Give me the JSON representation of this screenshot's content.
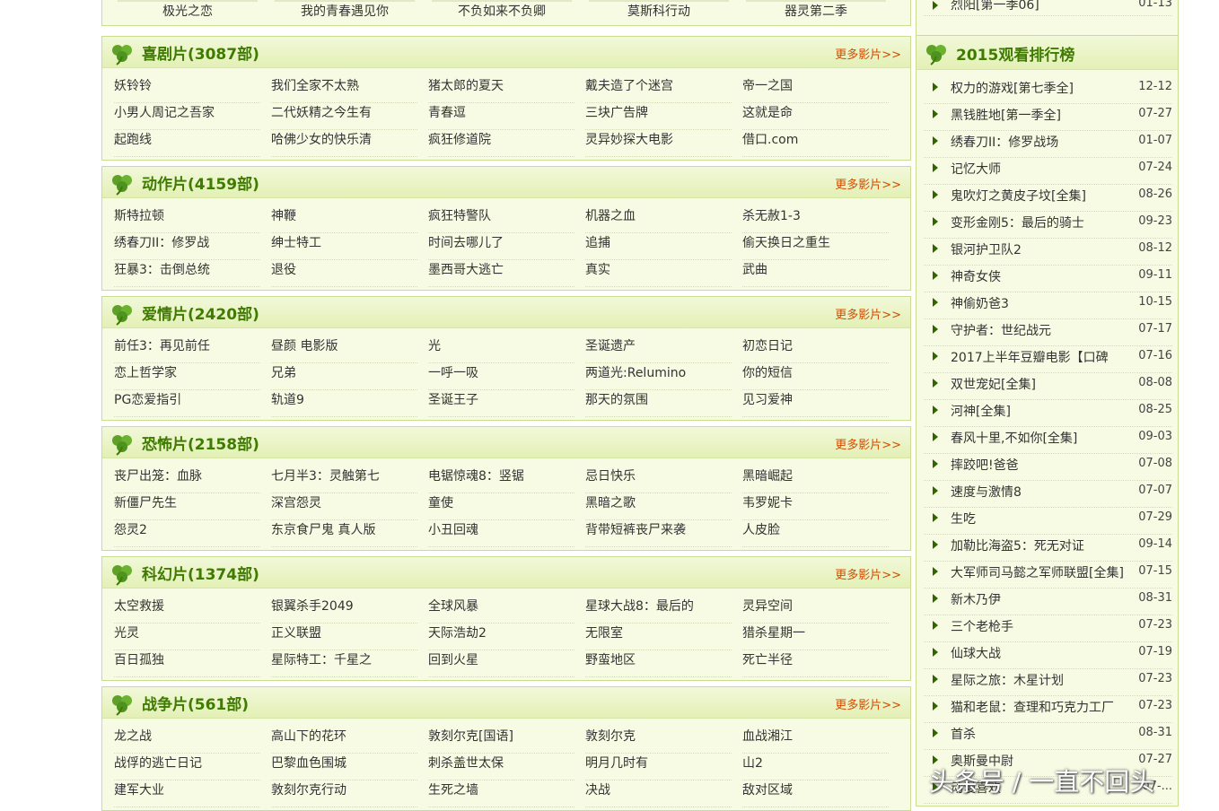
{
  "top_row": [
    "极光之恋",
    "我的青春遇见你",
    "不负如来不负卿",
    "莫斯科行动",
    "器灵第二季"
  ],
  "more_label": "更多影片>>",
  "sections": [
    {
      "title": "喜剧片(3087部)",
      "items": [
        "妖铃铃",
        "我们全家不太熟",
        "猪太郎的夏天",
        "戴夫造了个迷宫",
        "帝一之国",
        "小男人周记之吾家",
        "二代妖精之今生有",
        "青春逗",
        "三块广告牌",
        "这就是命",
        "起跑线",
        "哈佛少女的快乐清",
        "疯狂修道院",
        "灵异妙探大电影",
        "借口.com"
      ]
    },
    {
      "title": "动作片(4159部)",
      "items": [
        "斯特拉顿",
        "神鞭",
        "疯狂特警队",
        "机器之血",
        "杀无赦1-3",
        "绣春刀II：修罗战",
        "绅士特工",
        "时间去哪儿了",
        "追捕",
        "偷天换日之重生",
        "狂暴3：击倒总统",
        "退役",
        "墨西哥大逃亡",
        "真实",
        "武曲"
      ]
    },
    {
      "title": "爱情片(2420部)",
      "items": [
        "前任3：再见前任",
        "昼颜 电影版",
        "光",
        "圣诞遗产",
        "初恋日记",
        "恋上哲学家",
        "兄弟",
        "一呼一吸",
        "两道光:Relumino",
        "你的短信",
        "PG恋爱指引",
        "轨道9",
        "圣诞王子",
        "那天的氛围",
        "见习爱神"
      ]
    },
    {
      "title": "恐怖片(2158部)",
      "items": [
        "丧尸出笼：血脉",
        "七月半3：灵触第七",
        "电锯惊魂8：竖锯",
        "忌日快乐",
        "黑暗崛起",
        "新僵尸先生",
        "深宫怨灵",
        "童使",
        "黑暗之歌",
        "韦罗妮卡",
        "怨灵2",
        "东京食尸鬼 真人版",
        "小丑回魂",
        "背带短裤丧尸来袭",
        "人皮脸"
      ]
    },
    {
      "title": "科幻片(1374部)",
      "items": [
        "太空救援",
        "银翼杀手2049",
        "全球风暴",
        "星球大战8：最后的",
        "灵异空间",
        "光灵",
        "正义联盟",
        "天际浩劫2",
        "无限室",
        "猎杀星期一",
        "百日孤独",
        "星际特工：千星之",
        "回到火星",
        "野蛮地区",
        "死亡半径"
      ]
    },
    {
      "title": "战争片(561部)",
      "items": [
        "龙之战",
        "高山下的花环",
        "敦刻尔克[国语]",
        "敦刻尔克",
        "血战湘江",
        "战俘的逃亡日记",
        "巴黎血色围城",
        "刺杀盖世太保",
        "明月几时有",
        "山2",
        "建军大业",
        "敦刻尔克行动",
        "生死之墙",
        "决战",
        "敌对区域"
      ]
    }
  ],
  "sidebar": {
    "top_partial": {
      "title": "烈阳[第一季06]",
      "date": "01-13"
    },
    "title": "2015观看排行榜",
    "items": [
      {
        "title": "权力的游戏[第七季全]",
        "date": "12-12"
      },
      {
        "title": "黑钱胜地[第一季全]",
        "date": "07-27"
      },
      {
        "title": "绣春刀II：修罗战场",
        "date": "01-07"
      },
      {
        "title": "记忆大师",
        "date": "07-24"
      },
      {
        "title": "鬼吹灯之黄皮子坟[全集]",
        "date": "08-26"
      },
      {
        "title": "变形金刚5：最后的骑士",
        "date": "09-23"
      },
      {
        "title": "银河护卫队2",
        "date": "08-12"
      },
      {
        "title": "神奇女侠",
        "date": "09-11"
      },
      {
        "title": "神偷奶爸3",
        "date": "10-15"
      },
      {
        "title": "守护者：世纪战元",
        "date": "07-17"
      },
      {
        "title": "2017上半年豆瓣电影【口碑",
        "date": "07-16"
      },
      {
        "title": "双世宠妃[全集]",
        "date": "08-08"
      },
      {
        "title": "河神[全集]",
        "date": "08-25"
      },
      {
        "title": "春风十里,不如你[全集]",
        "date": "09-03"
      },
      {
        "title": "摔跤吧!爸爸",
        "date": "07-08"
      },
      {
        "title": "速度与激情8",
        "date": "07-07"
      },
      {
        "title": "生吃",
        "date": "07-29"
      },
      {
        "title": "加勒比海盗5：死无对证",
        "date": "09-14"
      },
      {
        "title": "大军师司马懿之军师联盟[全集]",
        "date": "07-15"
      },
      {
        "title": "新木乃伊",
        "date": "08-31"
      },
      {
        "title": "三个老枪手",
        "date": "07-23"
      },
      {
        "title": "仙球大战",
        "date": "07-19"
      },
      {
        "title": "星际之旅：木星计划",
        "date": "07-23"
      },
      {
        "title": "猫和老鼠：查理和巧克力工厂",
        "date": "07-23"
      },
      {
        "title": "首杀",
        "date": "08-31"
      },
      {
        "title": "奥斯曼中尉",
        "date": "07-27"
      },
      {
        "title": "动漫喜欢",
        "date": "07-..."
      }
    ]
  },
  "watermark": "头条号 / 一直不回头"
}
